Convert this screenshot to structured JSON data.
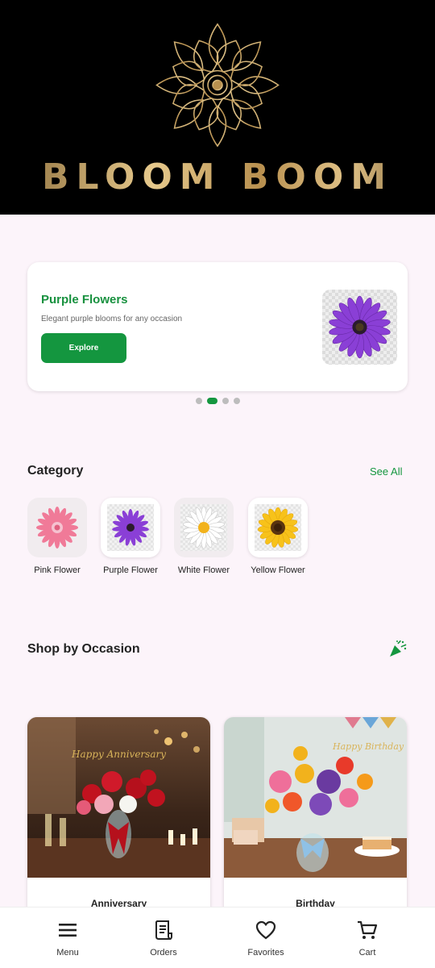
{
  "header": {
    "brand_name": "BLOOM BOOM",
    "logo_icon": "lotus-mandala-icon",
    "accent": "#b8904f"
  },
  "banner": {
    "title": "Purple Flowers",
    "subtitle": "Elegant purple blooms for any occasion",
    "button_label": "Explore",
    "image_icon": "purple-daisy-icon",
    "carousel_active_index": 1,
    "carousel_count": 4
  },
  "category": {
    "title": "Category",
    "see_all": "See All",
    "items": [
      {
        "label": "Pink Flower",
        "icon": "pink-gerbera-icon"
      },
      {
        "label": "Purple Flower",
        "icon": "purple-daisy-icon"
      },
      {
        "label": "White Flower",
        "icon": "white-daisy-icon"
      },
      {
        "label": "Yellow Flower",
        "icon": "sunflower-icon"
      }
    ]
  },
  "occasion": {
    "title": "Shop by Occasion",
    "icon": "party-popper-icon",
    "cards": [
      {
        "label": "Anniversary",
        "image_text": "Happy Anniversary"
      },
      {
        "label": "Birthday",
        "image_text": "Happy Birthday"
      }
    ]
  },
  "bottom_nav": [
    {
      "label": "Menu",
      "icon": "menu-icon"
    },
    {
      "label": "Orders",
      "icon": "receipt-icon"
    },
    {
      "label": "Favorites",
      "icon": "heart-icon"
    },
    {
      "label": "Cart",
      "icon": "cart-icon"
    }
  ],
  "colors": {
    "primary_green": "#14963f",
    "background": "#fcf4fa"
  }
}
